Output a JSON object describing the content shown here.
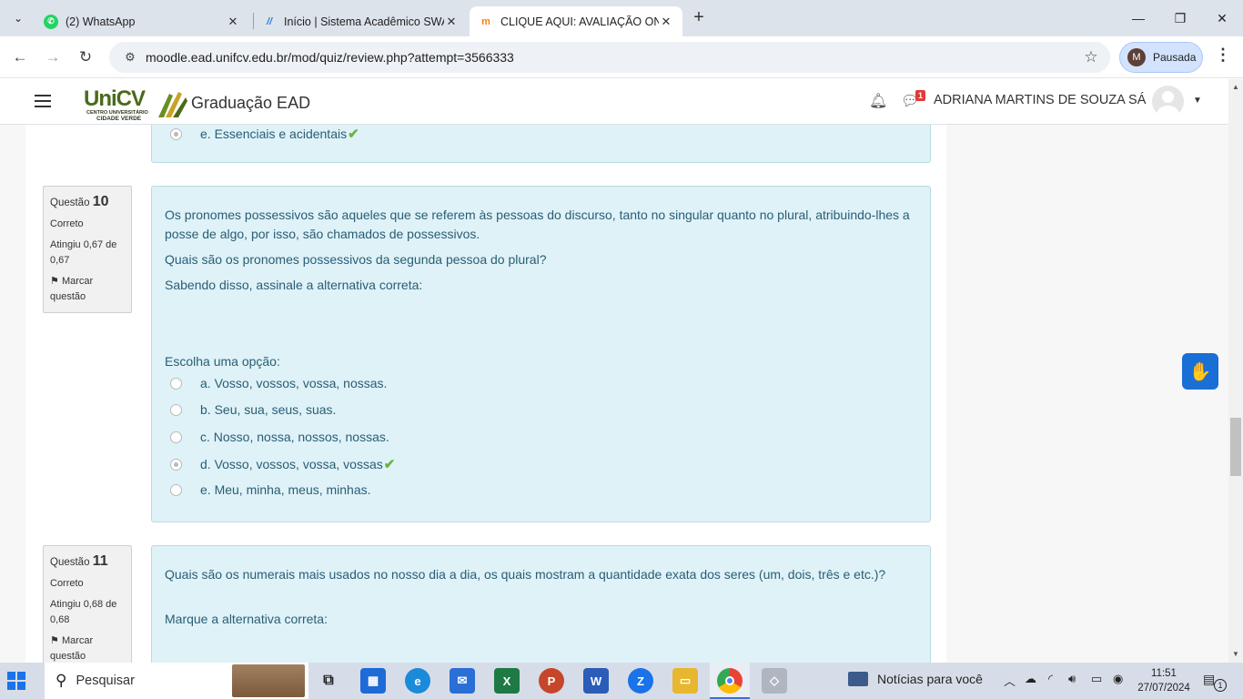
{
  "browser": {
    "tabs": [
      {
        "title": "(2) WhatsApp",
        "icon": "whatsapp-icon"
      },
      {
        "title": "Início | Sistema Acadêmico SWA",
        "icon": "swa-icon"
      },
      {
        "title": "CLIQUE AQUI: AVALIAÇÃO ONL",
        "icon": "moodle-icon"
      }
    ],
    "url": "moodle.ead.unifcv.edu.br/mod/quiz/review.php?attempt=3566333",
    "profile_initial": "M",
    "profile_label": "Pausada"
  },
  "header": {
    "logo_word": "UniCV",
    "logo_sub1": "CENTRO UNIVERSITÁRIO",
    "logo_sub2": "CIDADE VERDE",
    "title": "Graduação EAD",
    "chat_badge": "1",
    "username": "ADRIANA MARTINS DE SOUZA SÁ"
  },
  "prev_question": {
    "last_option": "e. Essenciais e acidentais"
  },
  "questions": [
    {
      "label": "Questão",
      "number": "10",
      "status": "Correto",
      "grade": "Atingiu 0,67 de 0,67",
      "flag": "Marcar questão",
      "text": [
        "Os pronomes possessivos são aqueles que se referem às pessoas do discurso, tanto no singular quanto no plural, atribuindo-lhes a posse de algo, por isso, são chamados de possessivos.",
        "Quais são os pronomes possessivos da segunda pessoa do plural?",
        "Sabendo disso, assinale a alternativa correta:"
      ],
      "prompt": "Escolha uma opção:",
      "options": [
        "a. Vosso, vossos, vossa, nossas.",
        "b. Seu, sua, seus, suas.",
        "c. Nosso, nossa, nossos, nossas.",
        "d. Vosso, vossos, vossa, vossas",
        "e. Meu, minha, meus, minhas."
      ],
      "selected_index": 3
    },
    {
      "label": "Questão",
      "number": "11",
      "status": "Correto",
      "grade": "Atingiu 0,68 de 0,68",
      "flag": "Marcar questão",
      "text": [
        "Quais são os numerais  mais usados no nosso dia a dia, os quais mostram a quantidade exata dos seres (um, dois, três e etc.)?",
        "Marque a alternativa correta:"
      ]
    }
  ],
  "taskbar": {
    "search_placeholder": "Pesquisar",
    "news": "Notícias para você",
    "time": "11:51",
    "date": "27/07/2024",
    "notif_count": "1"
  }
}
